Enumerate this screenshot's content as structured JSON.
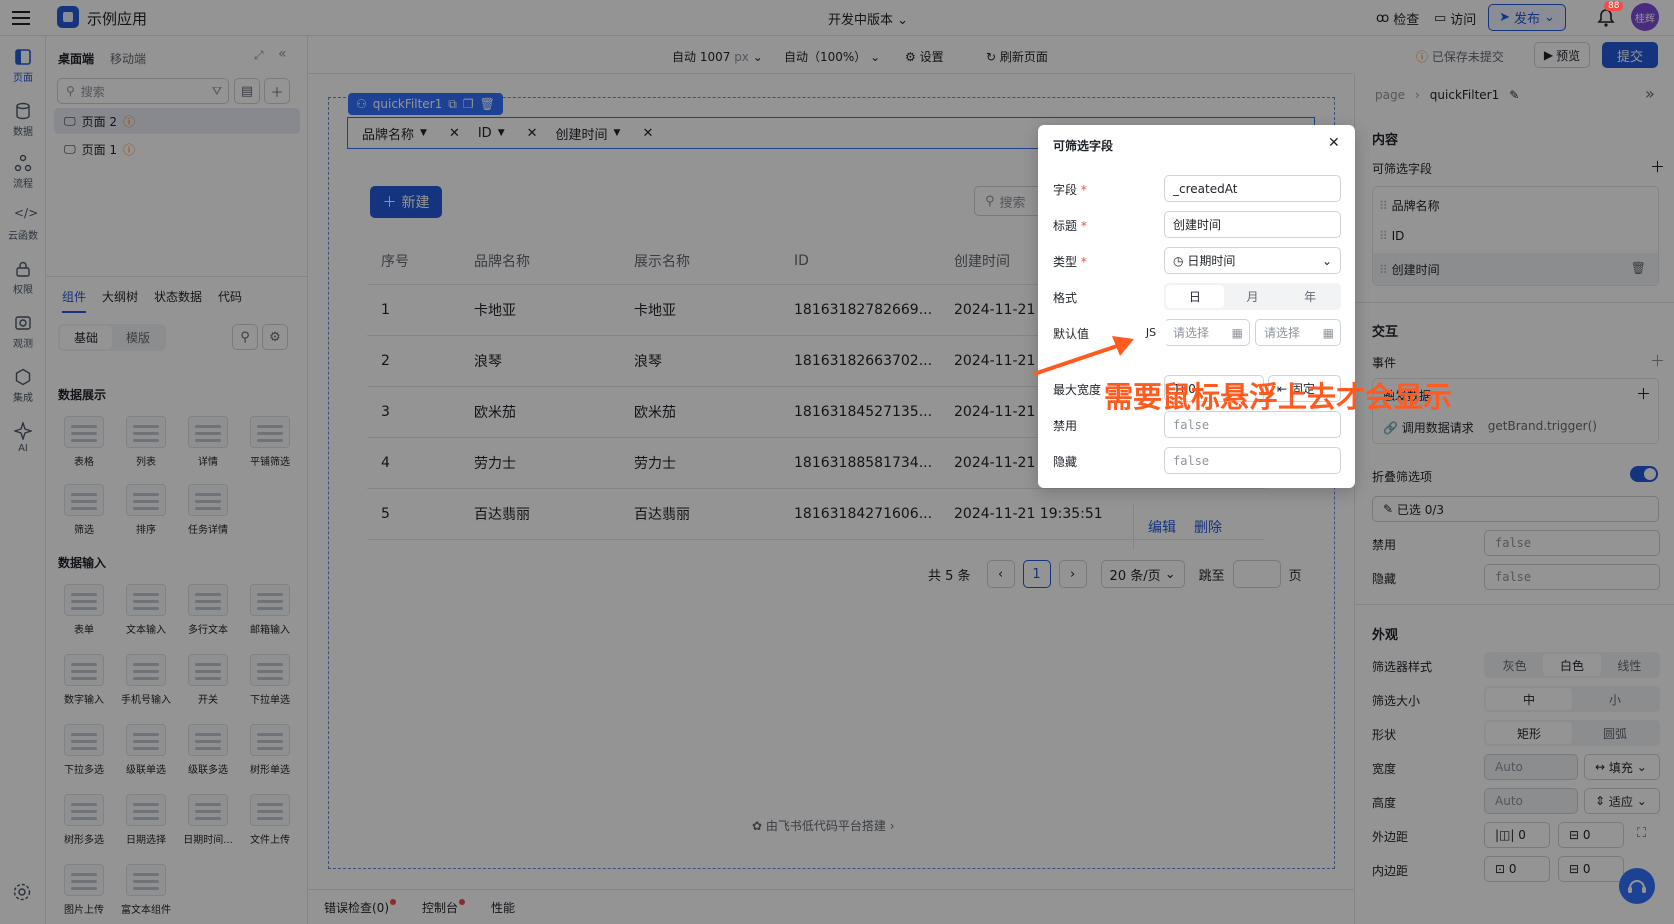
{
  "app": {
    "name": "示例应用",
    "version": "开发中版本"
  },
  "topbar": {
    "inspect": "检查",
    "visit": "访问",
    "publish": "发布",
    "notify_count": "88",
    "avatar": "桂辉"
  },
  "rail": [
    {
      "label": "页面",
      "icon": "page-icon"
    },
    {
      "label": "数据",
      "icon": "database-icon"
    },
    {
      "label": "流程",
      "icon": "flow-icon"
    },
    {
      "label": "云函数",
      "icon": "code-icon"
    },
    {
      "label": "权限",
      "icon": "lock-icon"
    },
    {
      "label": "观测",
      "icon": "monitor-icon"
    },
    {
      "label": "集成",
      "icon": "integration-icon"
    },
    {
      "label": "AI",
      "icon": "ai-sparkle-icon"
    }
  ],
  "left_panel": {
    "tabs": [
      "桌面端",
      "移动端"
    ],
    "search_placeholder": "搜索",
    "pages": [
      "页面 2",
      "页面 1"
    ],
    "lower_tabs": [
      "组件",
      "大纲树",
      "状态数据",
      "代码"
    ],
    "seg": [
      "基础",
      "模版"
    ],
    "group_display": "数据展示",
    "group_input": "数据输入",
    "display_components": [
      "表格",
      "列表",
      "详情",
      "平铺筛选",
      "筛选",
      "排序",
      "任务详情"
    ],
    "input_components": [
      "表单",
      "文本输入",
      "多行文本",
      "邮箱输入",
      "数字输入",
      "手机号输入",
      "开关",
      "下拉单选",
      "下拉多选",
      "级联单选",
      "级联多选",
      "树形单选",
      "树形多选",
      "日期选择",
      "日期时间...",
      "文件上传",
      "图片上传",
      "富文本组件"
    ]
  },
  "canvas_bar": {
    "width": "自动 1007",
    "width_unit": "px",
    "zoom": "自动（100%）",
    "settings": "设置",
    "refresh": "刷新页面",
    "unsaved": "已保存未提交",
    "preview": "预览",
    "submit": "提交"
  },
  "quickfilter": {
    "tag": "quickFilter1",
    "chips": [
      "品牌名称",
      "ID",
      "创建时间"
    ]
  },
  "table": {
    "new_button": "新建",
    "search_placeholder": "搜索",
    "columns": [
      "序号",
      "品牌名称",
      "展示名称",
      "ID",
      "创建时间"
    ],
    "rows": [
      [
        "1",
        "卡地亚",
        "卡地亚",
        "18163182782669...",
        "2024-11-21"
      ],
      [
        "2",
        "浪琴",
        "浪琴",
        "18163182663702...",
        "2024-11-21"
      ],
      [
        "3",
        "欧米茄",
        "欧米茄",
        "18163184527135...",
        "2024-11-21"
      ],
      [
        "4",
        "劳力士",
        "劳力士",
        "18163188581734...",
        "2024-11-21"
      ],
      [
        "5",
        "百达翡丽",
        "百达翡丽",
        "18163184271606...",
        "2024-11-21 19:35:51"
      ]
    ],
    "edit": "编辑",
    "delete": "删除",
    "total": "共 5 条",
    "current_page": "1",
    "page_size": "20 条/页",
    "jump_to": "跳至",
    "page_unit": "页"
  },
  "footer": "由飞书低代码平台搭建",
  "bottom_bar": [
    "错误检查(0)",
    "控制台",
    "性能"
  ],
  "popup": {
    "title": "可筛选字段",
    "field_label": "字段",
    "field_value": "_createdAt",
    "title_label": "标题",
    "title_value": "创建时间",
    "type_label": "类型",
    "type_value": "日期时间",
    "format_label": "格式",
    "format_options": [
      "日",
      "月",
      "年"
    ],
    "default_label": "默认值",
    "js": "JS",
    "placeholder1": "请选择",
    "placeholder2": "请选择",
    "maxwidth_label": "最大宽度",
    "maxwidth_value": "160",
    "maxwidth_btn": "固定",
    "disabled_label": "禁用",
    "disabled_value": "false",
    "hidden_label": "隐藏",
    "hidden_value": "false"
  },
  "annotation": "需要鼠标悬浮上去才会显示",
  "right_panel": {
    "breadcrumb": [
      "page",
      "quickFilter1"
    ],
    "content": "内容",
    "filter_fields": "可筛选字段",
    "fields": [
      "品牌名称",
      "ID",
      "创建时间"
    ],
    "interaction": "交互",
    "events": "事件",
    "call_data": "触发数据",
    "call_label": "调用数据请求",
    "call_value": "getBrand.trigger()",
    "collapse": "折叠筛选项",
    "selected": "已选 0/3",
    "disabled": "禁用",
    "disabled_value": "false",
    "hidden": "隐藏",
    "hidden_value": "false",
    "appearance": "外观",
    "style_label": "筛选器样式",
    "style_options": [
      "灰色",
      "白色",
      "线性"
    ],
    "size_label": "筛选大小",
    "size_options": [
      "中",
      "小"
    ],
    "shape_label": "形状",
    "shape_options": [
      "矩形",
      "圆弧"
    ],
    "width_label": "宽度",
    "width_value": "Auto",
    "width_mode": "填充",
    "height_label": "高度",
    "height_value": "Auto",
    "height_mode": "适应",
    "margin_label": "外边距",
    "margin_values": [
      "0",
      "0"
    ],
    "padding_label": "内边距",
    "padding_values": [
      "0",
      "0"
    ]
  },
  "colors": {
    "primary": "#245bdb",
    "annotation": "#ff5a1f",
    "danger": "#f54a45"
  }
}
